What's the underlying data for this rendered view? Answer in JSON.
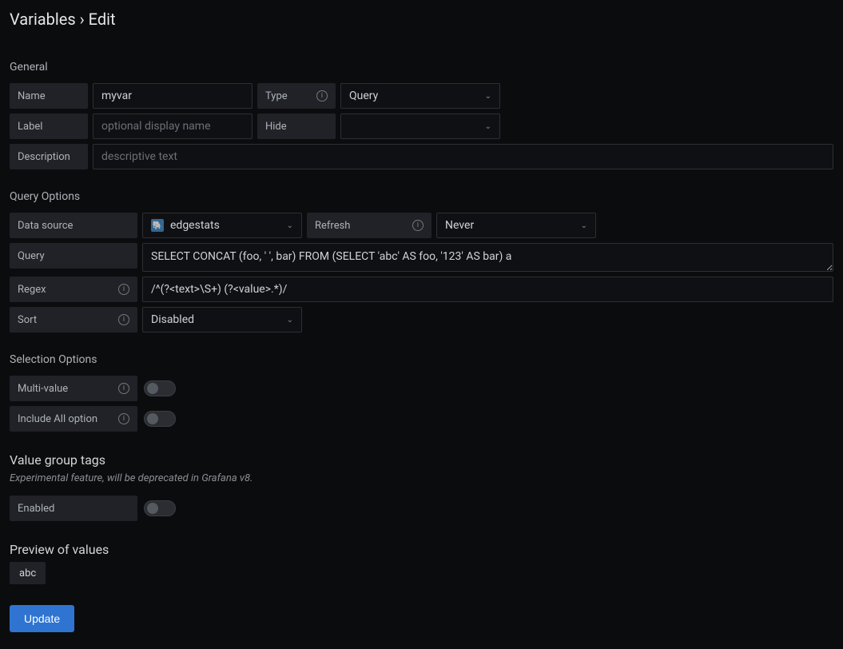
{
  "page": {
    "breadcrumb_prefix": "Variables",
    "breadcrumb_sep": " › ",
    "breadcrumb_current": "Edit"
  },
  "general": {
    "section_title": "General",
    "name_label": "Name",
    "name_value": "myvar",
    "type_label": "Type",
    "type_value": "Query",
    "label_label": "Label",
    "label_placeholder": "optional display name",
    "label_value": "",
    "hide_label": "Hide",
    "hide_value": "",
    "description_label": "Description",
    "description_placeholder": "descriptive text",
    "description_value": ""
  },
  "query_options": {
    "section_title": "Query Options",
    "data_source_label": "Data source",
    "data_source_value": "edgestats",
    "refresh_label": "Refresh",
    "refresh_value": "Never",
    "query_label": "Query",
    "query_value": "SELECT CONCAT (foo, ' ', bar) FROM (SELECT 'abc' AS foo, '123' AS bar) a",
    "regex_label": "Regex",
    "regex_value": "/^(?<text>\\S+) (?<value>.*)/",
    "sort_label": "Sort",
    "sort_value": "Disabled"
  },
  "selection_options": {
    "section_title": "Selection Options",
    "multi_value_label": "Multi-value",
    "multi_value_on": false,
    "include_all_label": "Include All option",
    "include_all_on": false
  },
  "value_group_tags": {
    "section_title": "Value group tags",
    "hint": "Experimental feature, will be deprecated in Grafana v8.",
    "enabled_label": "Enabled",
    "enabled_on": false
  },
  "preview": {
    "section_title": "Preview of values",
    "values": [
      "abc"
    ]
  },
  "actions": {
    "update_label": "Update"
  }
}
